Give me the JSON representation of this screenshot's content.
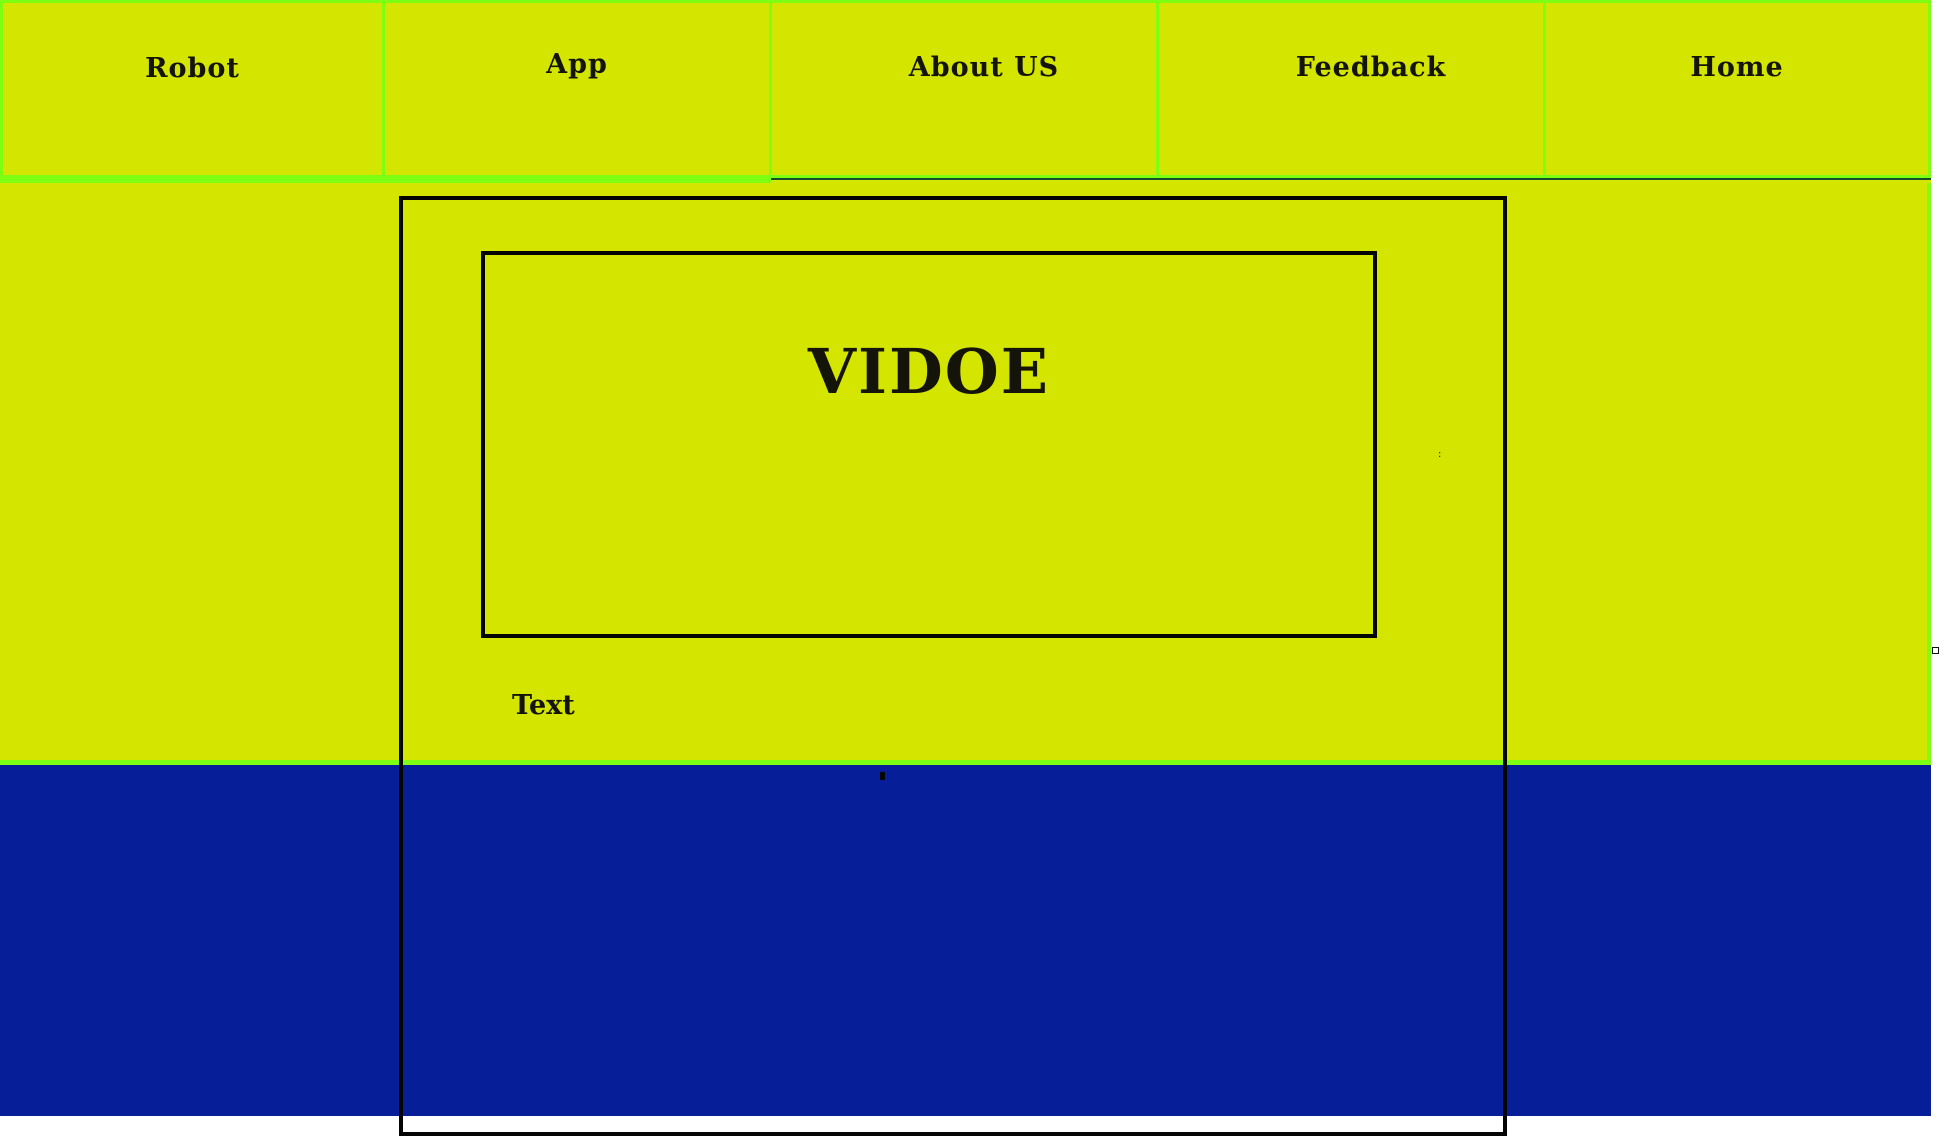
{
  "nav": {
    "items": [
      {
        "label": "Robot"
      },
      {
        "label": "App"
      },
      {
        "label": "About US"
      },
      {
        "label": "Feedback"
      },
      {
        "label": "Home"
      }
    ]
  },
  "main": {
    "video_title": "VIDOE",
    "text_label": "Text",
    "tiny_mark": ":"
  },
  "colors": {
    "yellow_background": "#d4e600",
    "blue_background": "#061f99",
    "green_border": "#7cff12",
    "frame_black": "#050505",
    "text_dark": "#14140a"
  }
}
